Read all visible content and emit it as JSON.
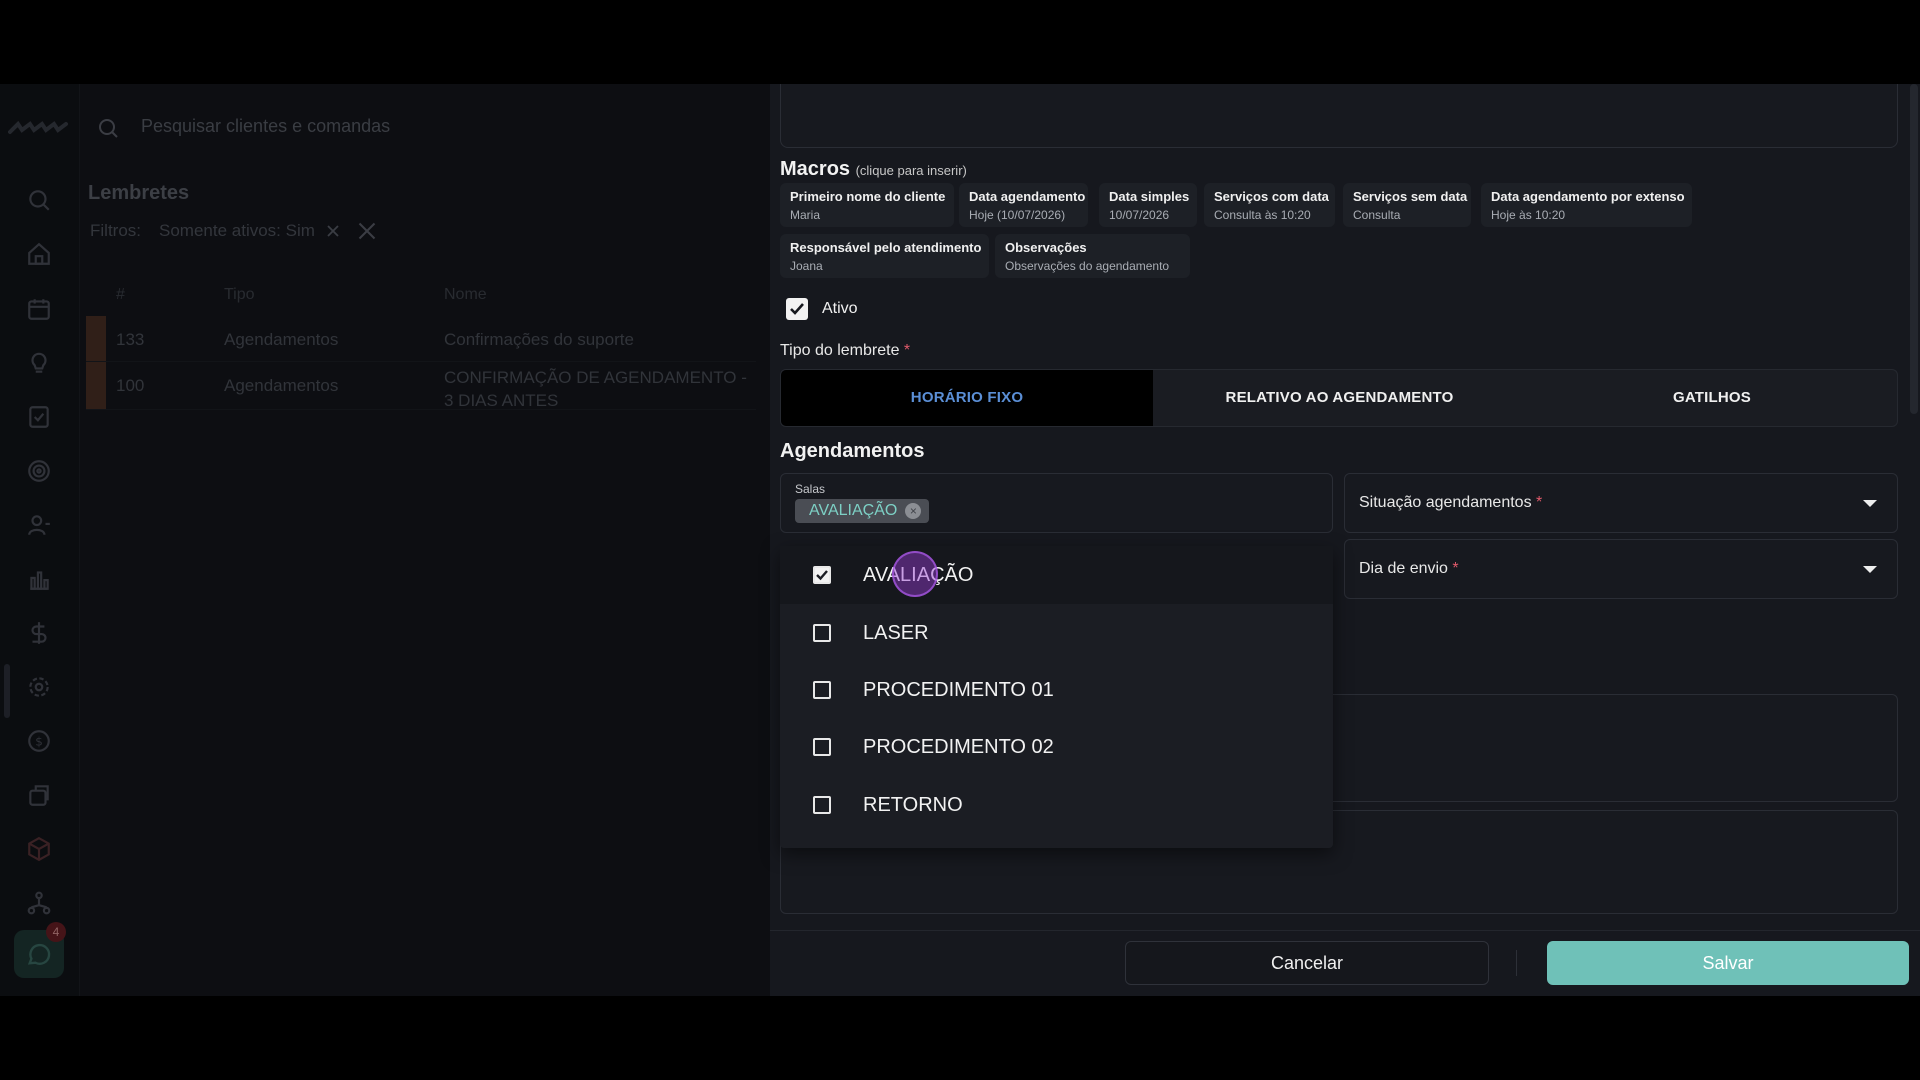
{
  "search": {
    "placeholder": "Pesquisar clientes e comandas"
  },
  "sidebar": {
    "icons": [
      "search-icon",
      "home-icon",
      "calendar-icon",
      "lightbulb-icon",
      "checklist-icon",
      "target-icon",
      "user-icon",
      "chart-icon",
      "dollar-icon",
      "gear-icon",
      "coin-icon",
      "box-icon",
      "cube-icon",
      "network-icon"
    ],
    "chat_badge": "4"
  },
  "list": {
    "title": "Lembretes",
    "filters_label": "Filtros:",
    "filter_chip": "Somente ativos: Sim",
    "columns": [
      "#",
      "Tipo",
      "Nome"
    ],
    "rows": [
      {
        "id": "133",
        "tipo": "Agendamentos",
        "nome": "Confirmações do suporte"
      },
      {
        "id": "100",
        "tipo": "Agendamentos",
        "nome": "CONFIRMAÇÃO DE AGENDAMENTO - 3 DIAS ANTES"
      }
    ]
  },
  "form": {
    "macros_title": "Macros",
    "macros_hint": "(clique para inserir)",
    "macros": [
      {
        "key": "Primeiro nome do cliente",
        "example": "Maria"
      },
      {
        "key": "Data agendamento",
        "example": "Hoje (10/07/2026)"
      },
      {
        "key": "Data simples",
        "example": "10/07/2026"
      },
      {
        "key": "Serviços com data",
        "example": "Consulta às 10:20"
      },
      {
        "key": "Serviços sem data",
        "example": "Consulta"
      },
      {
        "key": "Data agendamento por extenso",
        "example": "Hoje às 10:20"
      },
      {
        "key": "Responsável pelo atendimento",
        "example": "Joana"
      },
      {
        "key": "Observações",
        "example": "Observações do agendamento"
      }
    ],
    "ativo_label": "Ativo",
    "tipo_label": "Tipo do lembrete",
    "required_mark": "*",
    "tipo_options": [
      "HORÁRIO FIXO",
      "RELATIVO AO AGENDAMENTO",
      "GATILHOS"
    ],
    "tipo_selected": "HORÁRIO FIXO",
    "agendamentos_title": "Agendamentos",
    "salas_label": "Salas",
    "salas_selected": [
      "AVALIAÇÃO"
    ],
    "situacao_label": "Situação agendamentos",
    "dia_envio_label": "Dia de envio",
    "salas_options": [
      {
        "label": "AVALIAÇÃO",
        "checked": true
      },
      {
        "label": "LASER",
        "checked": false
      },
      {
        "label": "PROCEDIMENTO 01",
        "checked": false
      },
      {
        "label": "PROCEDIMENTO 02",
        "checked": false
      },
      {
        "label": "RETORNO",
        "checked": false
      }
    ],
    "cancel_label": "Cancelar",
    "save_label": "Salvar"
  },
  "colors": {
    "accent": "#6fc1b8",
    "tab_active_text": "#5b8fd6",
    "required": "#e05a6b"
  }
}
